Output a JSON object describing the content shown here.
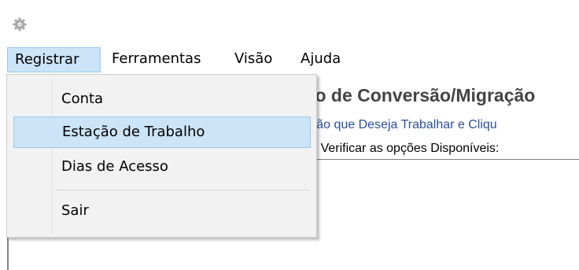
{
  "icons": {
    "app": "gear-icon"
  },
  "menu_bar": {
    "items": [
      {
        "label": "Registrar"
      },
      {
        "label": "Ferramentas"
      },
      {
        "label": "Visão"
      },
      {
        "label": "Ajuda"
      }
    ]
  },
  "dropdown": {
    "items": [
      {
        "label": "Conta"
      },
      {
        "label": "Estação de Trabalho"
      },
      {
        "label": "Dias de Acesso"
      },
      {
        "label": "Sair"
      }
    ]
  },
  "content": {
    "heading": "eto de Conversão/Migração",
    "subtext": "ração que Deseja Trabalhar e Cliqu",
    "subtext2": "ara Verificar as opções Disponíveis:"
  },
  "colors": {
    "highlight_bg": "#cce4f7",
    "highlight_border": "#99c9ef",
    "menu_bg": "#f2f2f2"
  }
}
